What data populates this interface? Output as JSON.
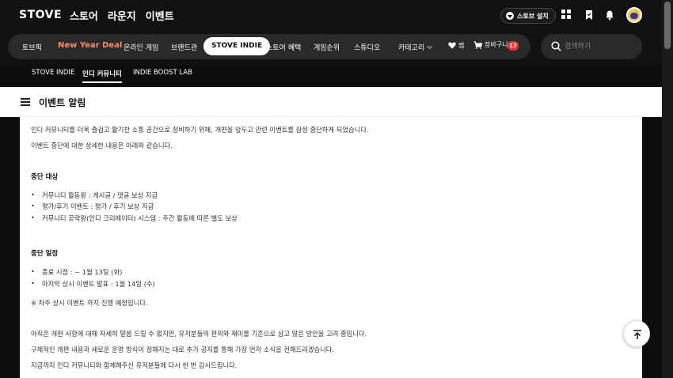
{
  "brand": "STOVE",
  "gnb": [
    "스토어",
    "라운지",
    "이벤트"
  ],
  "install_label": "스토브 설치",
  "nav": {
    "items": [
      "토브픽",
      "New Year Deal",
      "온라인 게임",
      "브랜드관",
      "STOVE INDIE",
      "스토어 혜택",
      "게임순위",
      "스튜디오",
      "카테고리"
    ],
    "wishlist": "찜",
    "cart": "장바구니",
    "cart_count": "17"
  },
  "search": {
    "placeholder": "검색하기"
  },
  "subnav": [
    "STOVE INDIE",
    "인디 커뮤니티",
    "INDIE BOOST LAB"
  ],
  "page": {
    "title": "이벤트 알림",
    "intro1": "인디 커뮤니티를 더욱 즐겁고 활기찬 소통 공간으로 정비하기 위해, 개편을 앞두고 관련 이벤트를 잠정 중단하게 되었습니다.",
    "intro2": "이벤트 중단에 대한 상세한 내용은 아래와 같습니다.",
    "section1_title": "중단 대상",
    "section1_items": [
      "커뮤니티 활동왕 : 게시글 / 댓글 보상 지급",
      "평가/후기 이벤트 : 평가 / 후기 보상 지급",
      "커뮤니티 공략왕(인디 크리에이터) 시스템 : 주간 활동에 따른 별도 보상"
    ],
    "section2_title": "중단 일정",
    "section2_items": [
      "종료 시점 : ~ 1월 13일 (화)",
      "마지막 상시 이벤트 발표 : 1월 14일 (수)"
    ],
    "note": "※ 차주 상시 이벤트 까지 진행 예정입니다.",
    "outro1": "아직은 개편 사항에 대해 자세히 말씀 드릴 수 없지만, 유저분들의 편의와 재미를 기준으로 삼고 많은 방안을 고려 중입니다.",
    "outro2": "구체적인 개편 내용과 새로운 운영 방식이 정해지는 대로 추가 공지를 통해 가장 먼저 소식을 전해드리겠습니다.",
    "outro3": "지금까지 인디 커뮤니티와 함께해주신 유저분들께 다시 한 번 감사드립니다."
  },
  "colors": {
    "accent_deal": "#ff8a65",
    "badge": "#e53935",
    "bg_dark": "#0d0d0d"
  }
}
